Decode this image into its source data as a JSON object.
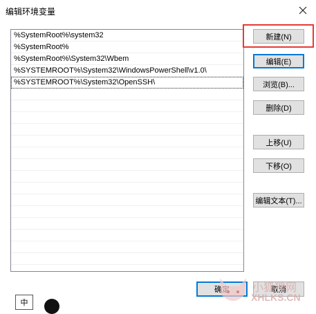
{
  "window": {
    "title": "编辑环境变量"
  },
  "paths": [
    "%SystemRoot%\\system32",
    "%SystemRoot%",
    "%SystemRoot%\\System32\\Wbem",
    "%SYSTEMROOT%\\System32\\WindowsPowerShell\\v1.0\\",
    "%SYSTEMROOT%\\System32\\OpenSSH\\"
  ],
  "buttons": {
    "new": "新建(N)",
    "edit": "编辑(E)",
    "browse": "浏览(B)...",
    "delete": "删除(D)",
    "move_up": "上移(U)",
    "move_down": "下移(O)",
    "edit_text": "编辑文本(T)...",
    "ok": "确定",
    "cancel": "取消"
  },
  "ime": {
    "label": "中"
  },
  "watermark": {
    "line1": "小狐狸网",
    "line2": "XHLKS.CN"
  },
  "colors": {
    "highlight": "#e53935",
    "focus_border": "#0078d7"
  }
}
